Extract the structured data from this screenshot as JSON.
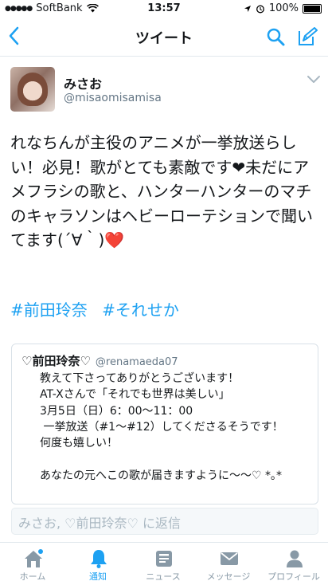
{
  "statusbar": {
    "carrier": "SoftBank",
    "time": "13:57",
    "battery": "100%"
  },
  "navbar": {
    "title": "ツイート"
  },
  "tweet": {
    "author_name": "みさお",
    "author_handle": "@misaomisamisa",
    "text": "れなちんが主役のアニメが一挙放送らしい！必見！歌がとても素敵です❤未だにアメフラシの歌と、ハンターハンターのマチのキャラソンはヘビーローテションで聞いてます(´∀｀)❤️",
    "hashtags": [
      "#前田玲奈",
      "#それせか"
    ]
  },
  "quote": {
    "name": "♡前田玲奈♡",
    "handle": "@renamaeda07",
    "text": "教えて下さってありがとうございます！\nAT-Xさんで「それでも世界は美しい」\n3月5日（日）6：00〜11：00\n 一挙放送（#1〜#12）してくださるそうです！\n何度も嬉しい！\n\nあなたの元へこの歌が届きますように〜〜♡ *｡*"
  },
  "reply": {
    "placeholder": "みさお, ♡前田玲奈♡ に返信"
  },
  "tabs": [
    {
      "label": "ホーム",
      "icon": "home-icon"
    },
    {
      "label": "通知",
      "icon": "bell-icon"
    },
    {
      "label": "ニュース",
      "icon": "news-icon"
    },
    {
      "label": "メッセージ",
      "icon": "envelope-icon"
    },
    {
      "label": "プロフィール",
      "icon": "person-icon"
    }
  ],
  "colors": {
    "accent": "#1da1f2",
    "inactive": "#8899a6",
    "text": "#14171a",
    "muted": "#657786"
  }
}
